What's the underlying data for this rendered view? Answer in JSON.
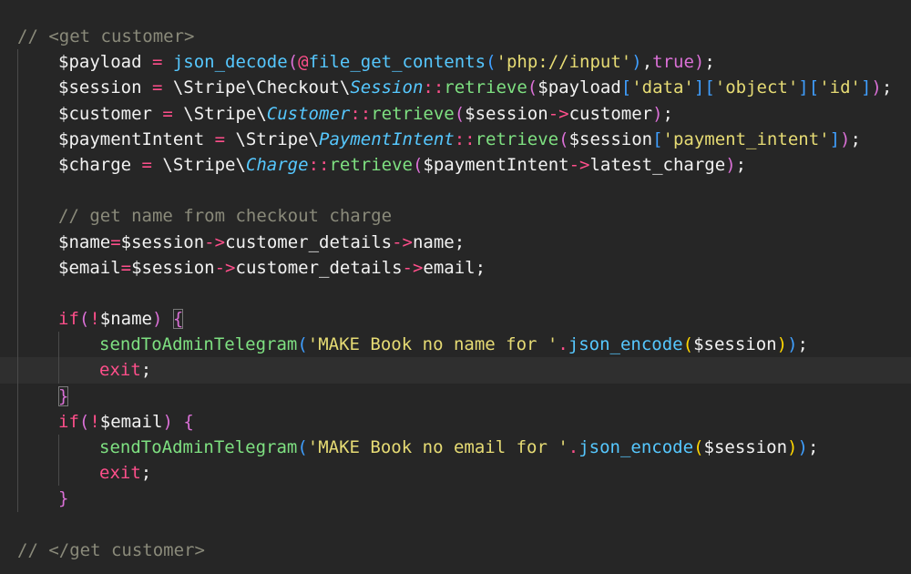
{
  "editor": {
    "language": "php",
    "colors": {
      "background": "#262626",
      "plain": "#f2f2f2",
      "comment": "#8a8a7a",
      "variable": "#f2f2f2",
      "operator": "#ff4f8b",
      "function": "#7ee081",
      "string": "#e6db74",
      "class": "#56c8ff",
      "keyword": "#ff4f8b",
      "paren_1": "#ffd700",
      "paren_2": "#da70d6",
      "paren_3": "#3f9fff"
    },
    "current_line": 13,
    "lines": [
      {
        "indent": 0,
        "tokens": [
          {
            "t": "// <get customer>",
            "c": "comment"
          }
        ]
      },
      {
        "indent": 1,
        "tokens": [
          {
            "t": "$payload",
            "c": "variable"
          },
          {
            "t": " = ",
            "c": "operator"
          },
          {
            "t": "json_decode",
            "c": "class"
          },
          {
            "t": "(",
            "c": "paren_2"
          },
          {
            "t": "@",
            "c": "operator"
          },
          {
            "t": "file_get_contents",
            "c": "class"
          },
          {
            "t": "(",
            "c": "paren_3"
          },
          {
            "t": "'php://input'",
            "c": "string"
          },
          {
            "t": ")",
            "c": "paren_3"
          },
          {
            "t": ",",
            "c": "plain"
          },
          {
            "t": "true",
            "c": "paren_2"
          },
          {
            "t": ")",
            "c": "paren_2"
          },
          {
            "t": ";",
            "c": "plain"
          }
        ]
      },
      {
        "indent": 1,
        "tokens": [
          {
            "t": "$session",
            "c": "variable"
          },
          {
            "t": " = ",
            "c": "operator"
          },
          {
            "t": "\\Stripe\\Checkout\\",
            "c": "plain"
          },
          {
            "t": "Session",
            "c": "class_italic"
          },
          {
            "t": "::",
            "c": "operator"
          },
          {
            "t": "retrieve",
            "c": "function"
          },
          {
            "t": "(",
            "c": "paren_2"
          },
          {
            "t": "$payload",
            "c": "variable"
          },
          {
            "t": "[",
            "c": "paren_3"
          },
          {
            "t": "'data'",
            "c": "string"
          },
          {
            "t": "]",
            "c": "paren_3"
          },
          {
            "t": "[",
            "c": "paren_3"
          },
          {
            "t": "'object'",
            "c": "string"
          },
          {
            "t": "]",
            "c": "paren_3"
          },
          {
            "t": "[",
            "c": "paren_3"
          },
          {
            "t": "'id'",
            "c": "string"
          },
          {
            "t": "]",
            "c": "paren_3"
          },
          {
            "t": ")",
            "c": "paren_2"
          },
          {
            "t": ";",
            "c": "plain"
          }
        ]
      },
      {
        "indent": 1,
        "tokens": [
          {
            "t": "$customer",
            "c": "variable"
          },
          {
            "t": " = ",
            "c": "operator"
          },
          {
            "t": "\\Stripe\\",
            "c": "plain"
          },
          {
            "t": "Customer",
            "c": "class_italic"
          },
          {
            "t": "::",
            "c": "operator"
          },
          {
            "t": "retrieve",
            "c": "function"
          },
          {
            "t": "(",
            "c": "paren_2"
          },
          {
            "t": "$session",
            "c": "variable"
          },
          {
            "t": "->",
            "c": "operator"
          },
          {
            "t": "customer",
            "c": "plain"
          },
          {
            "t": ")",
            "c": "paren_2"
          },
          {
            "t": ";",
            "c": "plain"
          }
        ]
      },
      {
        "indent": 1,
        "tokens": [
          {
            "t": "$paymentIntent",
            "c": "variable"
          },
          {
            "t": " = ",
            "c": "operator"
          },
          {
            "t": "\\Stripe\\",
            "c": "plain"
          },
          {
            "t": "PaymentIntent",
            "c": "class_italic"
          },
          {
            "t": "::",
            "c": "operator"
          },
          {
            "t": "retrieve",
            "c": "function"
          },
          {
            "t": "(",
            "c": "paren_2"
          },
          {
            "t": "$session",
            "c": "variable"
          },
          {
            "t": "[",
            "c": "paren_3"
          },
          {
            "t": "'payment_intent'",
            "c": "string"
          },
          {
            "t": "]",
            "c": "paren_3"
          },
          {
            "t": ")",
            "c": "paren_2"
          },
          {
            "t": ";",
            "c": "plain"
          }
        ]
      },
      {
        "indent": 1,
        "tokens": [
          {
            "t": "$charge",
            "c": "variable"
          },
          {
            "t": " = ",
            "c": "operator"
          },
          {
            "t": "\\Stripe\\",
            "c": "plain"
          },
          {
            "t": "Charge",
            "c": "class_italic"
          },
          {
            "t": "::",
            "c": "operator"
          },
          {
            "t": "retrieve",
            "c": "function"
          },
          {
            "t": "(",
            "c": "paren_2"
          },
          {
            "t": "$paymentIntent",
            "c": "variable"
          },
          {
            "t": "->",
            "c": "operator"
          },
          {
            "t": "latest_charge",
            "c": "plain"
          },
          {
            "t": ")",
            "c": "paren_2"
          },
          {
            "t": ";",
            "c": "plain"
          }
        ]
      },
      {
        "indent": 0,
        "tokens": []
      },
      {
        "indent": 1,
        "tokens": [
          {
            "t": "// get name from checkout charge",
            "c": "comment"
          }
        ]
      },
      {
        "indent": 1,
        "tokens": [
          {
            "t": "$name",
            "c": "variable"
          },
          {
            "t": "=",
            "c": "operator"
          },
          {
            "t": "$session",
            "c": "variable"
          },
          {
            "t": "->",
            "c": "operator"
          },
          {
            "t": "customer_details",
            "c": "plain"
          },
          {
            "t": "->",
            "c": "operator"
          },
          {
            "t": "name",
            "c": "plain"
          },
          {
            "t": ";",
            "c": "plain"
          }
        ]
      },
      {
        "indent": 1,
        "tokens": [
          {
            "t": "$email",
            "c": "variable"
          },
          {
            "t": "=",
            "c": "operator"
          },
          {
            "t": "$session",
            "c": "variable"
          },
          {
            "t": "->",
            "c": "operator"
          },
          {
            "t": "customer_details",
            "c": "plain"
          },
          {
            "t": "->",
            "c": "operator"
          },
          {
            "t": "email",
            "c": "plain"
          },
          {
            "t": ";",
            "c": "plain"
          }
        ]
      },
      {
        "indent": 0,
        "tokens": []
      },
      {
        "indent": 1,
        "tokens": [
          {
            "t": "if",
            "c": "keyword"
          },
          {
            "t": "(",
            "c": "paren_2"
          },
          {
            "t": "!",
            "c": "operator"
          },
          {
            "t": "$name",
            "c": "variable"
          },
          {
            "t": ")",
            "c": "paren_2"
          },
          {
            "t": " ",
            "c": "plain"
          },
          {
            "t": "{",
            "c": "paren_2",
            "box": true
          }
        ]
      },
      {
        "indent": 2,
        "tokens": [
          {
            "t": "sendToAdminTelegram",
            "c": "function"
          },
          {
            "t": "(",
            "c": "paren_3"
          },
          {
            "t": "'MAKE Book no name for '",
            "c": "string"
          },
          {
            "t": ".",
            "c": "operator"
          },
          {
            "t": "json_encode",
            "c": "class"
          },
          {
            "t": "(",
            "c": "paren_1"
          },
          {
            "t": "$session",
            "c": "variable"
          },
          {
            "t": ")",
            "c": "paren_1"
          },
          {
            "t": ")",
            "c": "paren_3"
          },
          {
            "t": ";",
            "c": "plain"
          }
        ]
      },
      {
        "indent": 2,
        "tokens": [
          {
            "t": "exit",
            "c": "keyword"
          },
          {
            "t": ";",
            "c": "plain"
          }
        ]
      },
      {
        "indent": 1,
        "tokens": [
          {
            "t": "}",
            "c": "paren_2",
            "box": true
          }
        ]
      },
      {
        "indent": 1,
        "tokens": [
          {
            "t": "if",
            "c": "keyword"
          },
          {
            "t": "(",
            "c": "paren_2"
          },
          {
            "t": "!",
            "c": "operator"
          },
          {
            "t": "$email",
            "c": "variable"
          },
          {
            "t": ")",
            "c": "paren_2"
          },
          {
            "t": " ",
            "c": "plain"
          },
          {
            "t": "{",
            "c": "paren_2"
          }
        ]
      },
      {
        "indent": 2,
        "tokens": [
          {
            "t": "sendToAdminTelegram",
            "c": "function"
          },
          {
            "t": "(",
            "c": "paren_3"
          },
          {
            "t": "'MAKE Book no email for '",
            "c": "string"
          },
          {
            "t": ".",
            "c": "operator"
          },
          {
            "t": "json_encode",
            "c": "class"
          },
          {
            "t": "(",
            "c": "paren_1"
          },
          {
            "t": "$session",
            "c": "variable"
          },
          {
            "t": ")",
            "c": "paren_1"
          },
          {
            "t": ")",
            "c": "paren_3"
          },
          {
            "t": ";",
            "c": "plain"
          }
        ]
      },
      {
        "indent": 2,
        "tokens": [
          {
            "t": "exit",
            "c": "keyword"
          },
          {
            "t": ";",
            "c": "plain"
          }
        ]
      },
      {
        "indent": 1,
        "tokens": [
          {
            "t": "}",
            "c": "paren_2"
          }
        ]
      },
      {
        "indent": 0,
        "tokens": []
      },
      {
        "indent": 0,
        "tokens": [
          {
            "t": "// </get customer>",
            "c": "comment"
          }
        ]
      }
    ]
  }
}
